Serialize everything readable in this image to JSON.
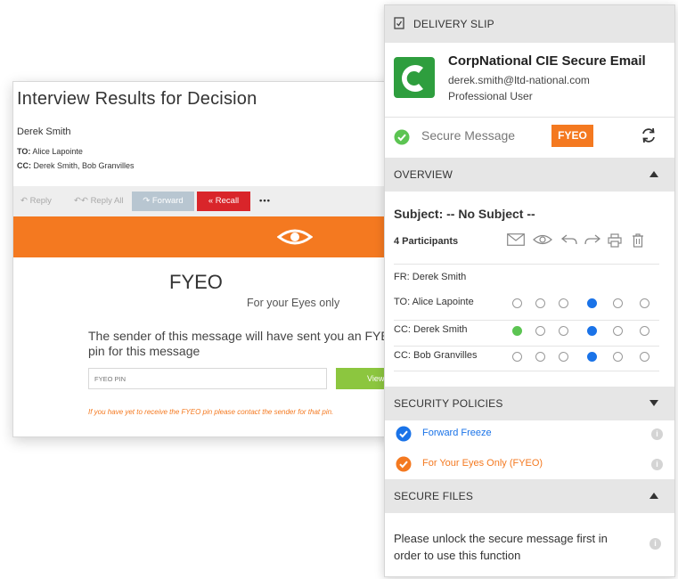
{
  "email": {
    "subject": "Interview Results for Decision",
    "from": "Derek Smith",
    "to_label": "TO:",
    "to_value": "Alice Lapointe",
    "cc_label": "CC:",
    "cc_value": "Derek Smith, Bob Granvilles",
    "actions": {
      "reply": "Reply",
      "reply_all": "Reply All",
      "forward": "Forward",
      "recall": "Recall",
      "more": "•••"
    },
    "fyeo_title": "FYEO",
    "fyeo_subtitle": "For your Eyes only",
    "fyeo_message": "The sender of this message will have sent you an FYEO pin for this message",
    "pin_placeholder": "FYEO PIN",
    "view_label": "View",
    "note": "If you have yet to receive the FYEO pin please contact the sender for that pin.",
    "colors": {
      "banner": "#f47920",
      "recall": "#d9252a",
      "view": "#8cc63f",
      "forward": "#b8c6d1"
    }
  },
  "slip": {
    "header": "DELIVERY SLIP",
    "app_name": "CorpNational CIE Secure Email",
    "user_email": "derek.smith@ltd-national.com",
    "user_role": "Professional User",
    "secure_label": "Secure Message",
    "badge": "FYEO",
    "overview": {
      "title": "OVERVIEW",
      "subject": "Subject: -- No Subject --",
      "participants_label": "4 Participants",
      "column_icons": [
        "envelope-icon",
        "eye-icon",
        "reply-icon",
        "forward-icon",
        "print-icon",
        "trash-icon"
      ],
      "rows": [
        {
          "label": "FR:  Derek Smith",
          "dots": []
        },
        {
          "label": "TO:  Alice Lapointe",
          "dots": [
            "none",
            "none",
            "none",
            "blue",
            "none",
            "none"
          ]
        },
        {
          "label": "CC:  Derek Smith",
          "dots": [
            "green",
            "none",
            "none",
            "blue",
            "none",
            "none"
          ]
        },
        {
          "label": "CC:  Bob Granvilles",
          "dots": [
            "none",
            "none",
            "none",
            "blue",
            "none",
            "none"
          ]
        }
      ]
    },
    "security_policies": {
      "title": "SECURITY POLICIES",
      "items": [
        {
          "label": "Forward Freeze",
          "color": "#1a73e8"
        },
        {
          "label": "For Your Eyes Only (FYEO)",
          "color": "#f47920"
        }
      ]
    },
    "secure_files": {
      "title": "SECURE FILES",
      "text": "Please unlock the secure message first in order to use this function"
    },
    "colors": {
      "accent_green": "#5cc452",
      "accent_blue": "#1a73e8",
      "accent_orange": "#f47920",
      "logo_green": "#2e9e3e"
    }
  }
}
